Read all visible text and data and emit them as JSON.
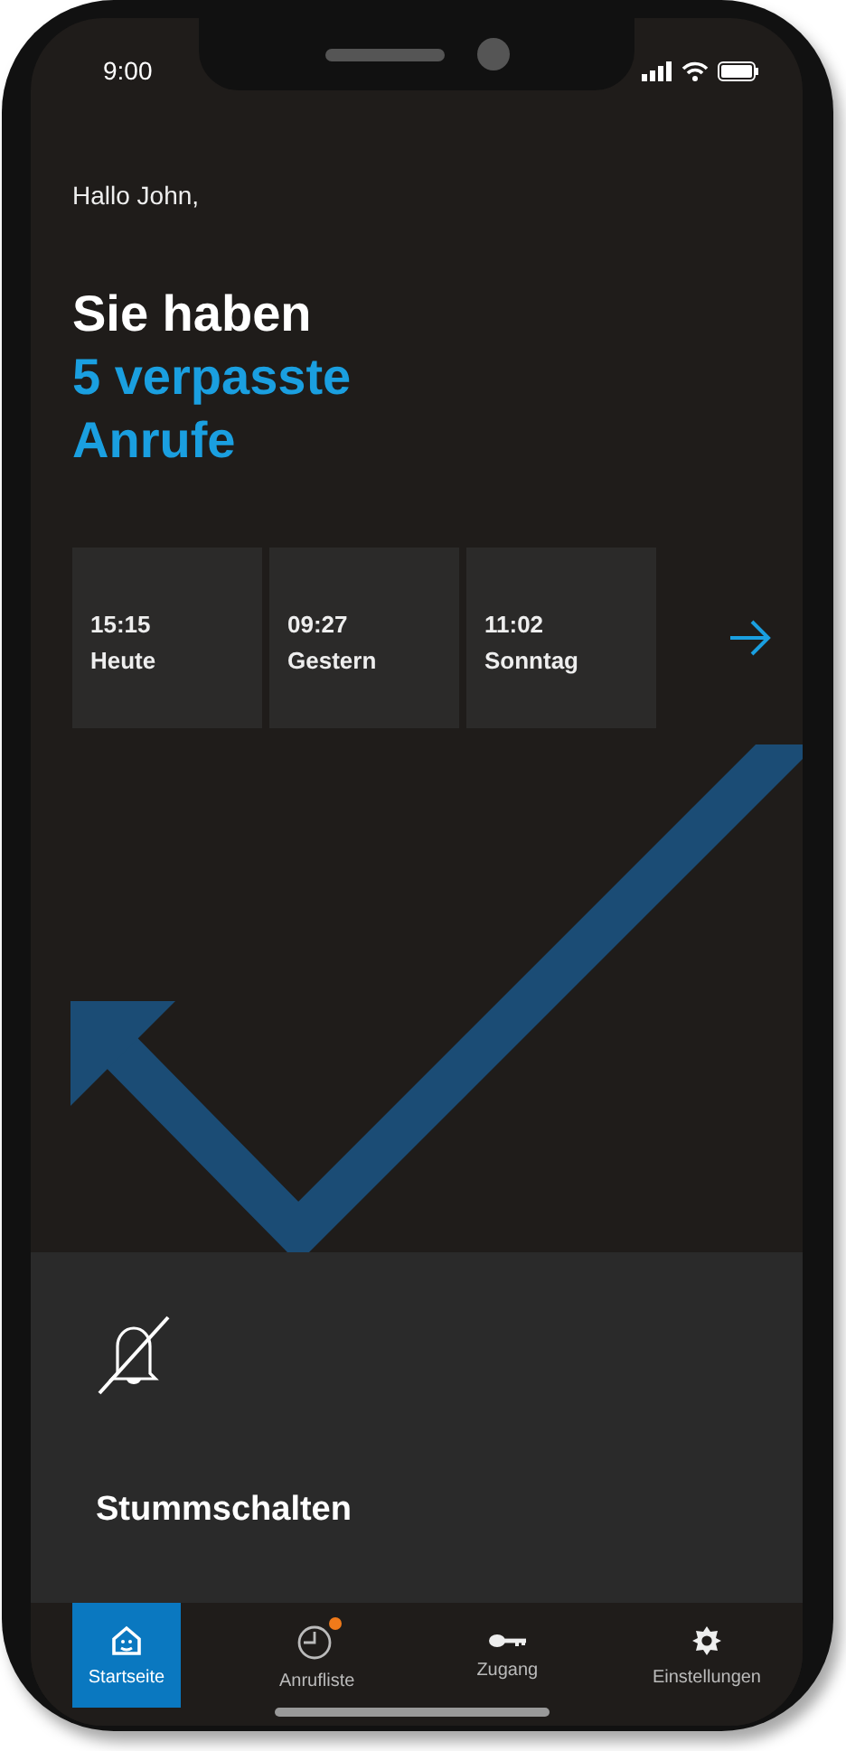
{
  "status_bar": {
    "time": "9:00"
  },
  "greeting": "Hallo John,",
  "headline": {
    "line": "Sie haben",
    "highlight": "5 verpasste Anrufe"
  },
  "missed_calls": [
    {
      "time": "15:15",
      "day": "Heute"
    },
    {
      "time": "09:27",
      "day": "Gestern"
    },
    {
      "time": "11:02",
      "day": "Sonntag"
    }
  ],
  "mute_panel": {
    "label": "Stummschalten"
  },
  "nav": [
    {
      "kind": "home",
      "label": "Startseite",
      "selected": true,
      "notification": false
    },
    {
      "kind": "calls",
      "label": "Anrufliste",
      "selected": false,
      "notification": true
    },
    {
      "kind": "key",
      "label": "Zugang",
      "selected": false,
      "notification": false
    },
    {
      "kind": "settings",
      "label": "Einstellungen",
      "selected": false,
      "notification": false
    }
  ]
}
